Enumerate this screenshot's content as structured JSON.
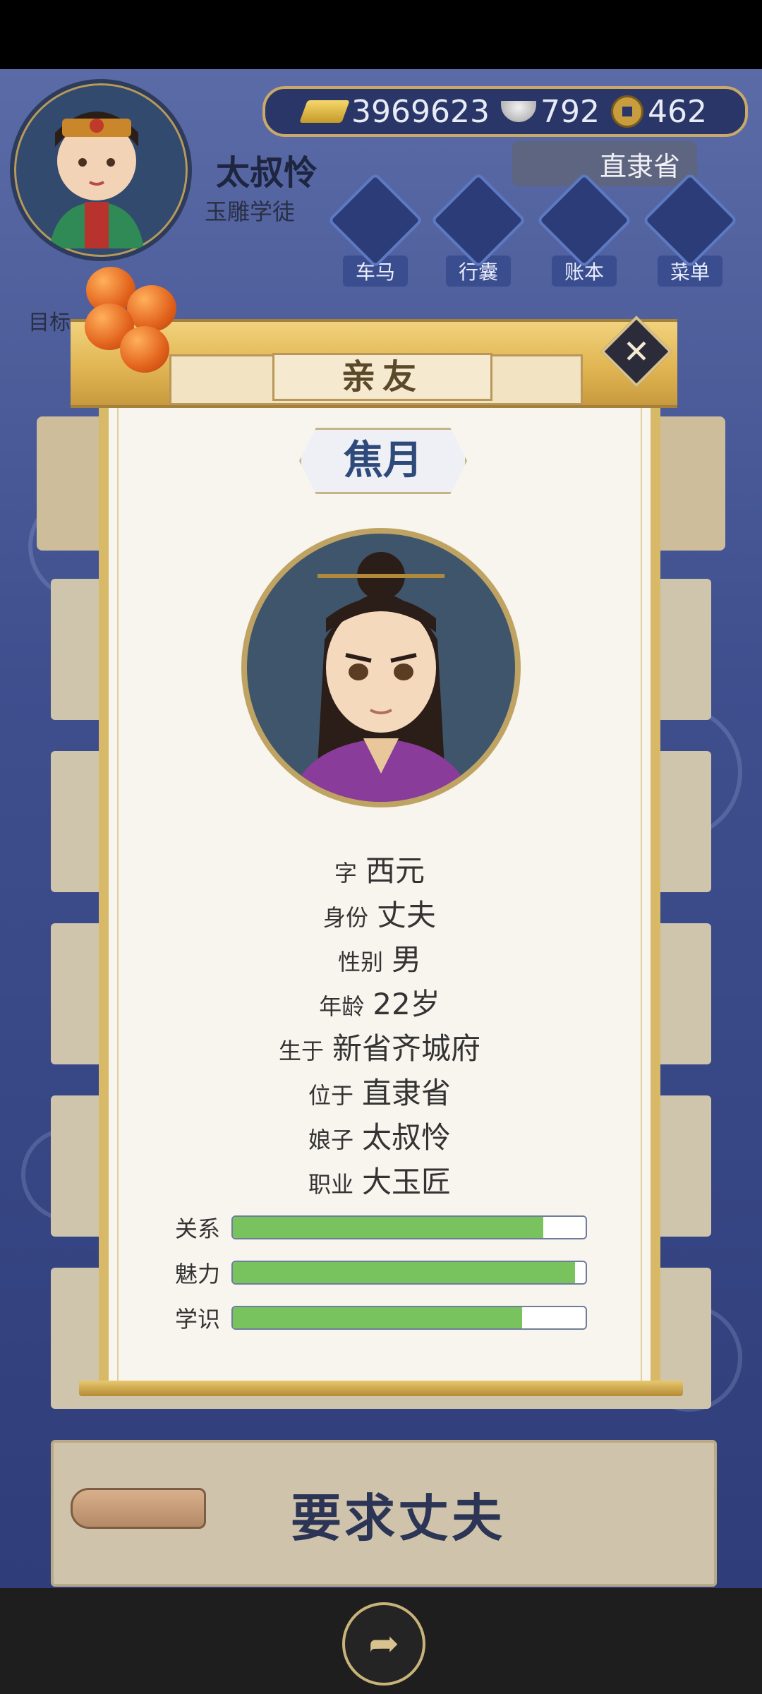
{
  "header": {
    "player_name": "太叔怜",
    "player_title": "玉雕学徒",
    "currency": {
      "gold": "3969623",
      "silver": "792",
      "coins": "462"
    },
    "location": "直隶省",
    "menu": [
      {
        "label": "车马",
        "icon": "carriage-icon"
      },
      {
        "label": "行囊",
        "icon": "bag-icon"
      },
      {
        "label": "账本",
        "icon": "ledger-icon"
      },
      {
        "label": "菜单",
        "icon": "menu-dots-icon"
      }
    ],
    "target_label": "目标"
  },
  "modal": {
    "title": "亲友",
    "person_name": "焦月",
    "info": [
      {
        "key": "字",
        "value": "西元"
      },
      {
        "key": "身份",
        "value": "丈夫"
      },
      {
        "key": "性别",
        "value": "男"
      },
      {
        "key": "年龄",
        "value": "22岁"
      },
      {
        "key": "生于",
        "value": "新省齐城府"
      },
      {
        "key": "位于",
        "value": "直隶省"
      },
      {
        "key": "娘子",
        "value": "太叔怜"
      },
      {
        "key": "职业",
        "value": "大玉匠"
      }
    ],
    "stats": [
      {
        "label": "关系",
        "fraction": 0.88
      },
      {
        "label": "魅力",
        "fraction": 0.97
      },
      {
        "label": "学识",
        "fraction": 0.82
      }
    ]
  },
  "action_button": {
    "label": "要求丈夫"
  },
  "colors": {
    "accent_gold": "#d8b968",
    "stat_fill": "#79c35f",
    "name_blue": "#2d4a7a",
    "bg_blue": "#3f4f8e"
  }
}
